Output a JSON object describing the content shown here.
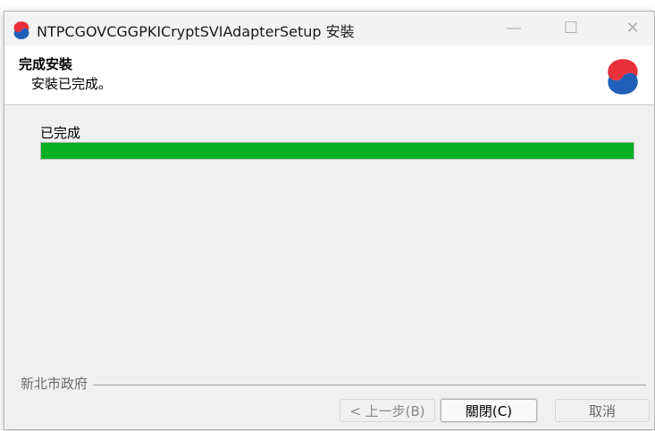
{
  "window": {
    "title": "NTPCGOVCGGPKICryptSVIAdapterSetup 安裝",
    "minimize_glyph": "—",
    "maximize_glyph": "☐",
    "close_glyph": "✕",
    "icon": "app-logo-icon"
  },
  "header": {
    "title": "完成安裝",
    "subtitle": "安裝已完成。",
    "logo": "app-logo-icon"
  },
  "main": {
    "status_text": "已完成",
    "progress_percent": 100
  },
  "footer": {
    "branding": "新北市政府",
    "buttons": {
      "back": "< 上一步(B)",
      "close": "關閉(C)",
      "cancel": "取消"
    }
  },
  "colors": {
    "progress": "#06b025",
    "logo_red": "#e8303a",
    "logo_blue": "#1f5fb8"
  }
}
